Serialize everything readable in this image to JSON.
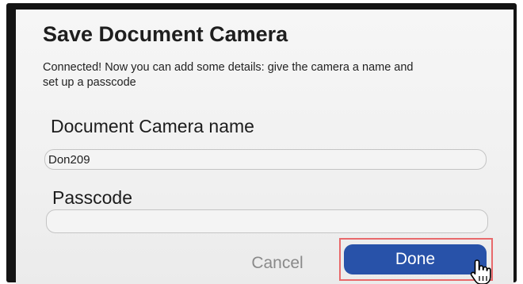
{
  "dialog": {
    "title": "Save Document Camera",
    "description": "Connected! Now you can add some details: give the camera a name and set up a passcode",
    "name_field": {
      "label": "Document Camera name",
      "value": "Don209",
      "placeholder": ""
    },
    "passcode_field": {
      "label": "Passcode",
      "value": "",
      "placeholder": ""
    },
    "buttons": {
      "cancel_label": "Cancel",
      "done_label": "Done"
    }
  },
  "colors": {
    "primary_button": "#2852a9",
    "highlight_outline": "#e8696b",
    "cancel_text": "#8a8a8a"
  },
  "icons": {
    "cursor": "hand-pointer-icon"
  }
}
